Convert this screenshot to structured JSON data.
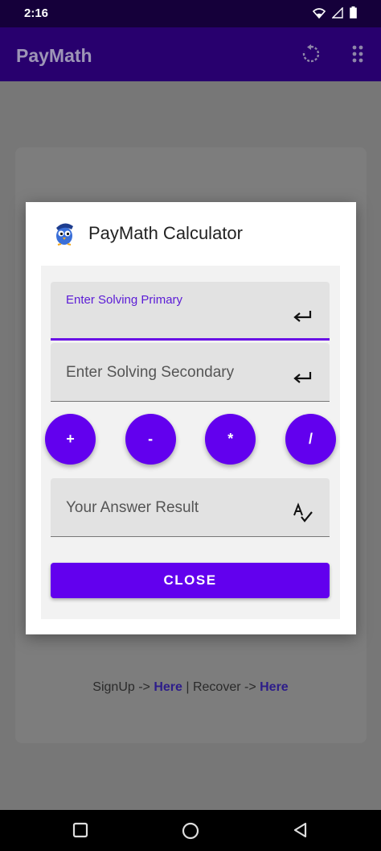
{
  "status_bar": {
    "time": "2:16"
  },
  "app_bar": {
    "title": "PayMath",
    "icons": [
      "refresh-icon",
      "more-grid-icon"
    ]
  },
  "background": {
    "footer_signup": "SignUp -> ",
    "footer_here_1": "Here",
    "footer_sep": " | Recover -> ",
    "footer_here_2": "Here"
  },
  "dialog": {
    "title": "PayMath Calculator",
    "primary_field": {
      "label": "Enter Solving Primary",
      "value": ""
    },
    "secondary_field": {
      "placeholder": "Enter Solving Secondary",
      "value": ""
    },
    "operators": [
      "+",
      "-",
      "*",
      "/"
    ],
    "result_field": {
      "placeholder": "Your Answer Result"
    },
    "close_label": "CLOSE"
  },
  "colors": {
    "accent": "#6200ee",
    "app_bar": "#28006e",
    "status_bar": "#15003a"
  }
}
